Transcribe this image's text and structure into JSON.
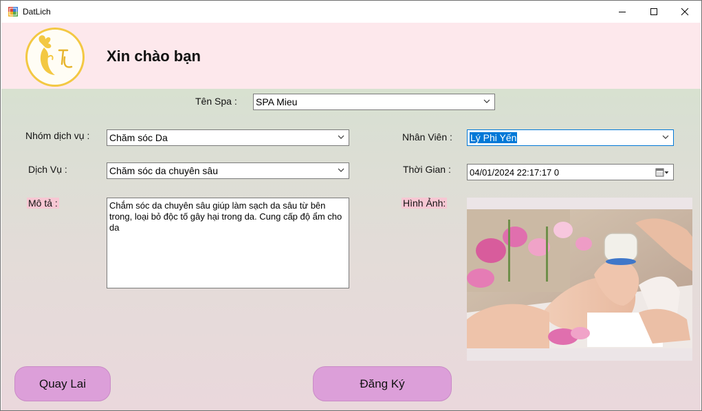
{
  "window": {
    "title": "DatLich"
  },
  "header": {
    "greeting": "Xin chào bạn"
  },
  "form": {
    "spa": {
      "label": "Tên Spa :",
      "value": "SPA Mieu"
    },
    "nhom_dich_vu": {
      "label": "Nhóm dịch vụ :",
      "value": "Chăm sóc Da"
    },
    "dich_vu": {
      "label": "Dịch Vụ :",
      "value": "Chăm sóc da chuyên sâu"
    },
    "mo_ta": {
      "label": "Mô tả :",
      "value": "Chắm sóc da chuyên sâu giúp làm sạch da sâu từ bên trong, loại bỏ độc tố gây hại trong da. Cung cấp độ ẩm cho da"
    },
    "nhan_vien": {
      "label": "Nhân Viên :",
      "value": "Lý Phi Yến"
    },
    "thoi_gian": {
      "label": "Thời Gian :",
      "value": "04/01/2024 22:17:17  0"
    },
    "hinh_anh": {
      "label": "Hình Ảnh:"
    }
  },
  "buttons": {
    "back": "Quay Lai",
    "register": "Đăng Ký"
  },
  "colors": {
    "header_bg": "#fde8ec",
    "button_bg": "#dc9fd9",
    "logo_gold": "#f3c843",
    "selection": "#0078d7"
  },
  "icons": {
    "app": "app-icon",
    "minimize": "minimize-icon",
    "maximize": "maximize-icon",
    "close": "close-icon",
    "calendar": "calendar-icon"
  }
}
